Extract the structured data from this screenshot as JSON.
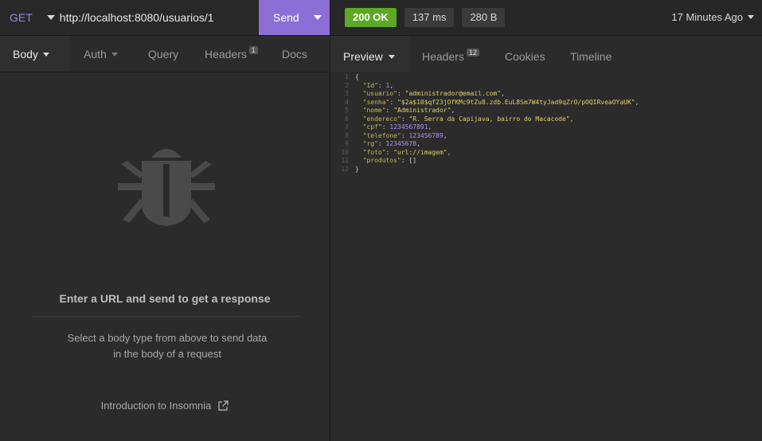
{
  "request": {
    "method": "GET",
    "url": "http://localhost:8080/usuarios/1",
    "send_label": "Send"
  },
  "response": {
    "status": "200 OK",
    "time": "137 ms",
    "size": "280 B",
    "ago": "17 Minutes Ago"
  },
  "left_tabs": {
    "body": "Body",
    "auth": "Auth",
    "query": "Query",
    "headers": "Headers",
    "headers_count": "1",
    "docs": "Docs"
  },
  "right_tabs": {
    "preview": "Preview",
    "headers": "Headers",
    "headers_count": "12",
    "cookies": "Cookies",
    "timeline": "Timeline"
  },
  "empty_state": {
    "title": "Enter a URL and send to get a response",
    "desc_line1": "Select a body type from above to send data",
    "desc_line2": "in the body of a request",
    "intro_link": "Introduction to Insomnia",
    "icon": "bug-icon"
  },
  "preview_lines": [
    {
      "n": "1",
      "t": "{"
    },
    {
      "n": "2",
      "k": "\"Id\"",
      "v": "1",
      "type": "num"
    },
    {
      "n": "3",
      "k": "\"usuario\"",
      "v": "\"administrador@email.com\"",
      "type": "str"
    },
    {
      "n": "4",
      "k": "\"senha\"",
      "v": "\"$2a$10$qf23jOfKMc9tZu8.zdb.EuL8Sm7W4tyJad9qZrO/pOQIRveaOYaUK\"",
      "type": "str"
    },
    {
      "n": "5",
      "k": "\"nome\"",
      "v": "\"Administrador\"",
      "type": "str"
    },
    {
      "n": "6",
      "k": "\"endereco\"",
      "v": "\"R. Serra da Capijava, bairro do Macacode\"",
      "type": "str"
    },
    {
      "n": "7",
      "k": "\"cpf\"",
      "v": "1234567891",
      "type": "num"
    },
    {
      "n": "8",
      "k": "\"telefone\"",
      "v": "123456789",
      "type": "num"
    },
    {
      "n": "9",
      "k": "\"rg\"",
      "v": "12345678",
      "type": "num"
    },
    {
      "n": "10",
      "k": "\"foto\"",
      "v": "\"url://imagem\"",
      "type": "str"
    },
    {
      "n": "11",
      "k": "\"produtos\"",
      "v": "[]",
      "type": "arr",
      "last": true
    },
    {
      "n": "12",
      "t": "}"
    }
  ]
}
